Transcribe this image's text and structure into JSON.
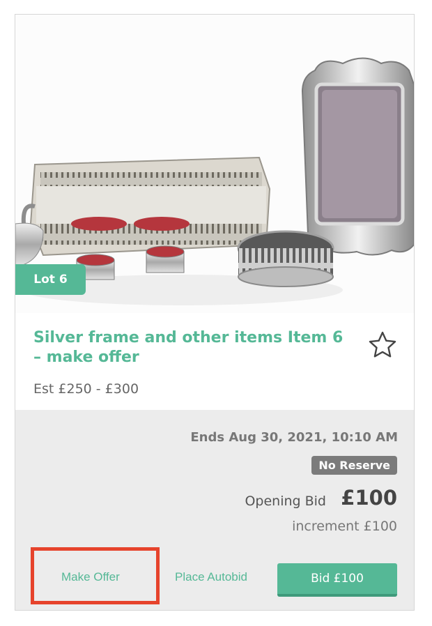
{
  "lot": {
    "badge_label": "Lot 6",
    "title": "Silver frame and other items Item 6 – make offer",
    "estimate": "Est £250 - £300",
    "favourite_icon": "star-outline-icon",
    "image_subject": "silver-items-photo"
  },
  "auction": {
    "ends": "Ends Aug 30, 2021, 10:10 AM",
    "reserve_badge": "No Reserve",
    "opening_bid_label": "Opening Bid",
    "opening_bid_value": "£100",
    "increment": "increment £100"
  },
  "actions": {
    "make_offer": "Make Offer",
    "place_autobid": "Place Autobid",
    "bid": "Bid £100"
  },
  "colors": {
    "accent": "#55b896",
    "badge_grey": "#7b7b7b",
    "panel_bg": "#ececec",
    "highlight": "#e6432c"
  }
}
